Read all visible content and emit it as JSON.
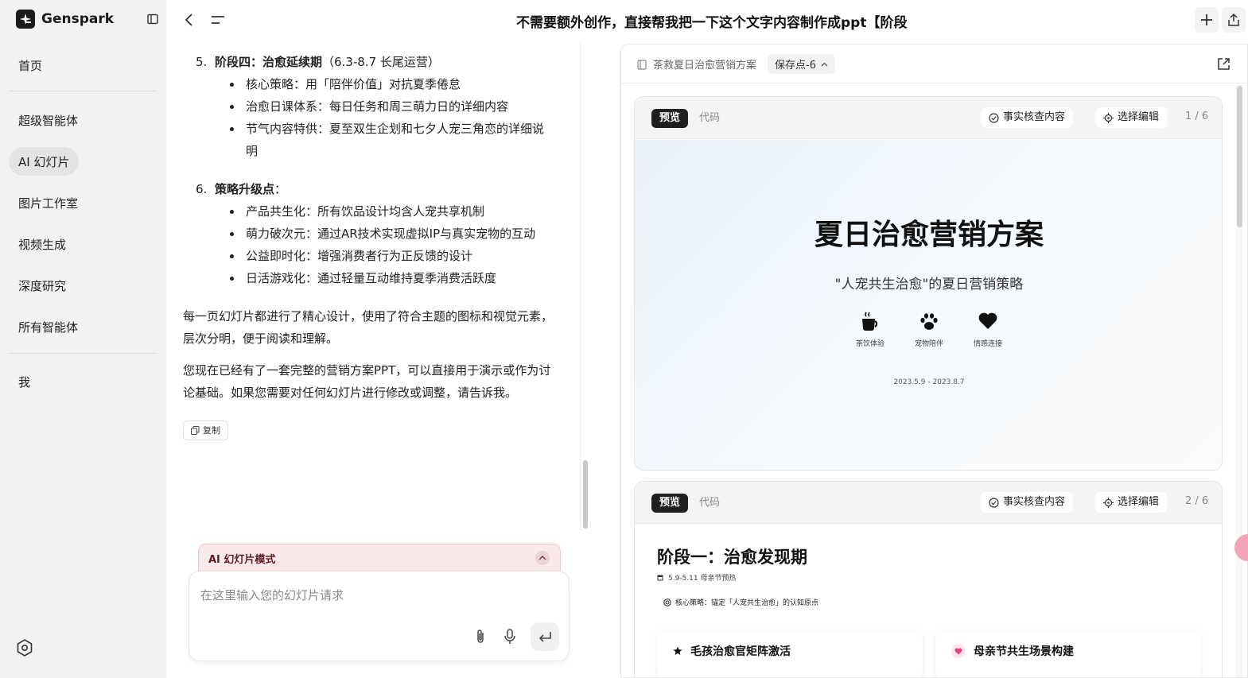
{
  "app": {
    "name": "Genspark"
  },
  "sidebar": {
    "items": [
      {
        "label": "首页"
      },
      {
        "label": "超级智能体"
      },
      {
        "label": "AI 幻灯片"
      },
      {
        "label": "图片工作室"
      },
      {
        "label": "视频生成"
      },
      {
        "label": "深度研究"
      },
      {
        "label": "所有智能体"
      },
      {
        "label": "我"
      }
    ]
  },
  "header": {
    "title": "不需要额外创作，直接帮我把一下这个文字内容制作成ppt【阶段"
  },
  "chat": {
    "section5": {
      "num": "5.",
      "title": "阶段四：治愈延续期",
      "title_suffix": "（6.3-8.7 长尾运营）",
      "bullets": [
        "核心策略：用「陪伴价值」对抗夏季倦怠",
        "治愈日课体系：每日任务和周三萌力日的详细内容",
        "节气内容特供：夏至双生企划和七夕人宠三角恋的详细说",
        "明"
      ]
    },
    "section6": {
      "num": "6.",
      "title": "策略升级点",
      "title_suffix": "：",
      "bullets": [
        "产品共生化：所有饮品设计均含人宠共享机制",
        "萌力破次元：通过AR技术实现虚拟IP与真实宠物的互动",
        "公益即时化：增强消费者行为正反馈的设计",
        "日活游戏化：通过轻量互动维持夏季消费活跃度"
      ]
    },
    "para1": [
      "每一页幻灯片都进行了精心设计，使用了符合主题的图标和视觉元素，",
      "层次分明，便于阅读和理解。"
    ],
    "para2": [
      "您现在已经有了一套完整的营销方案PPT，可以直接用于演示或作为讨",
      "论基础。如果您需要对任何幻灯片进行修改或调整，请告诉我。"
    ],
    "copy_label": "复制",
    "mode_label": "AI 幻灯片模式",
    "input_placeholder": "在这里输入您的幻灯片请求"
  },
  "panel": {
    "doc_name": "茶救夏日治愈营销方案",
    "save_point": "保存点-6",
    "cards": [
      {
        "tab_preview": "预览",
        "tab_code": "代码",
        "fact_check": "事实核查内容",
        "select_edit": "选择编辑",
        "page": "1 / 6"
      },
      {
        "tab_preview": "预览",
        "tab_code": "代码",
        "fact_check": "事实核查内容",
        "select_edit": "选择编辑",
        "page": "2 / 6"
      }
    ],
    "slide1": {
      "title": "夏日治愈营销方案",
      "subtitle": "\"人宠共生治愈\"的夏日营销策略",
      "features": [
        {
          "icon": "coffee-cup-icon",
          "label": "茶饮体验"
        },
        {
          "icon": "paw-icon",
          "label": "宠物陪伴"
        },
        {
          "icon": "heart-icon",
          "label": "情感连接"
        }
      ],
      "date": "2023.5.9 - 2023.8.7"
    },
    "slide2": {
      "title": "阶段一：治愈发现期",
      "date": "5.9-5.11 母亲节预热",
      "core": "核心策略：锚定「人宠共生治愈」的认知原点",
      "boxes": [
        {
          "icon": "star-icon",
          "label": "毛孩治愈官矩阵激活"
        },
        {
          "icon": "heart-icon",
          "label": "母亲节共生场景构建"
        }
      ]
    }
  }
}
